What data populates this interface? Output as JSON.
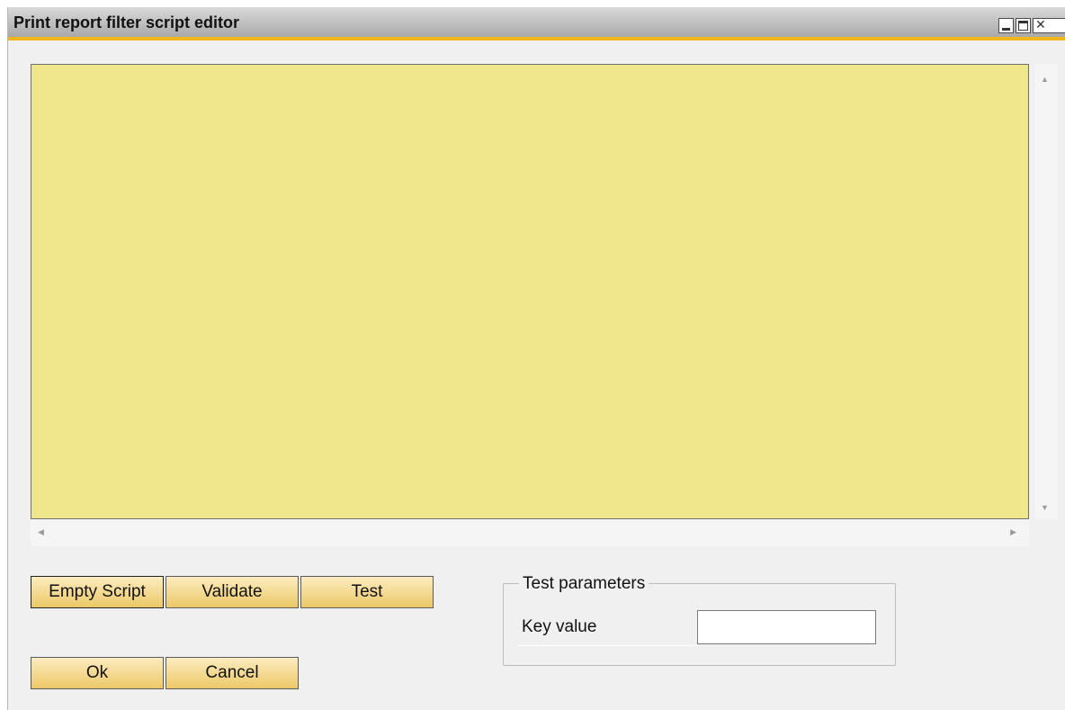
{
  "window": {
    "title": "Print report filter script editor"
  },
  "editor": {
    "content": ""
  },
  "buttons": {
    "empty_script": "Empty Script",
    "validate": "Validate",
    "test": "Test",
    "ok": "Ok",
    "cancel": "Cancel"
  },
  "test_parameters": {
    "legend": "Test parameters",
    "key_value_label": "Key value",
    "key_value": ""
  },
  "colors": {
    "editor_background": "#f0e68c",
    "title_accent": "#f2b51e",
    "button_gold": "#f3d88e"
  },
  "icons": {
    "scroll_up": "scroll-up-icon",
    "scroll_down": "scroll-down-icon",
    "scroll_left": "scroll-left-icon",
    "scroll_right": "scroll-right-icon"
  }
}
